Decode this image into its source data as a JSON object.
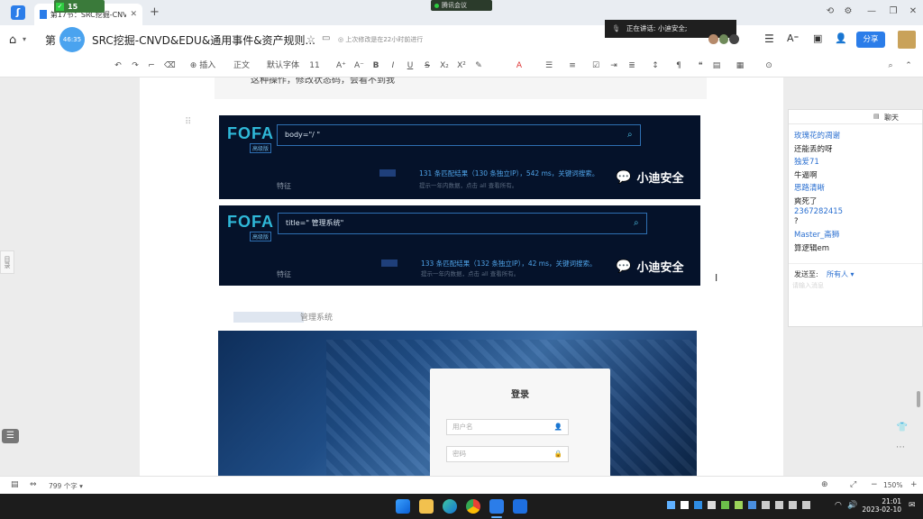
{
  "browser": {
    "tab_counter": "15",
    "tab_title": "第17节：SRC挖掘-CNV...",
    "meeting_label": "腾讯会议",
    "new_tab": "+"
  },
  "doc": {
    "heading_prefix": "第",
    "timer_badge": "46:35",
    "title": "SRC挖掘-CNVD&EDU&通用事件&资产规则...",
    "save_status": "上次修改是在22小时前进行",
    "speaking": "正在讲话: 小迪安全;",
    "share_label": "分享"
  },
  "toolbar": {
    "insert": "插入",
    "style": "正文",
    "font": "默认字体",
    "size": "11"
  },
  "content": {
    "top_text": "这种操作，修改状态码，会看不到我",
    "fofa1": {
      "logo": "FOFA",
      "sub": "高级版",
      "query": "body=\"/                     \"",
      "count_line": "131 条匹配结果（130 条独立IP），542 ms，关键词搜索。",
      "hint": "提示一年内数据，点击 all 查看所有。",
      "feature": "特征",
      "wechat": "小迪安全"
    },
    "fofa2": {
      "logo": "FOFA",
      "sub": "高级版",
      "query": "title=\"         管理系统\"",
      "count_line": "133 条匹配结果（132 条独立IP），42 ms，关键词搜索。",
      "hint": "提示一年内数据，点击 all 查看所有。",
      "feature": "特征",
      "wechat": "小迪安全"
    },
    "caption": "管理系统",
    "login": {
      "title": "登录",
      "username_ph": "用户名",
      "password_ph": "密码"
    }
  },
  "chat": {
    "title": "聊天",
    "messages": [
      {
        "name": "玫瑰花的凋谢",
        "text": "还能丢的呀"
      },
      {
        "name": "独爱71",
        "text": "牛逼啊"
      },
      {
        "name": "思路清晰",
        "text": "爽死了"
      },
      {
        "name": "2367282415",
        "text": "?"
      },
      {
        "name": "Master_斋狮",
        "text": "算逻辑em"
      }
    ],
    "send_to_label": "发送至:",
    "send_to_value": "所有人",
    "input_placeholder": "请输入消息"
  },
  "statusbar": {
    "side_label": "目录",
    "word_count": "799 个字",
    "zoom": "150%"
  },
  "taskbar": {
    "time": "21:01",
    "date": "2023-02-10"
  }
}
